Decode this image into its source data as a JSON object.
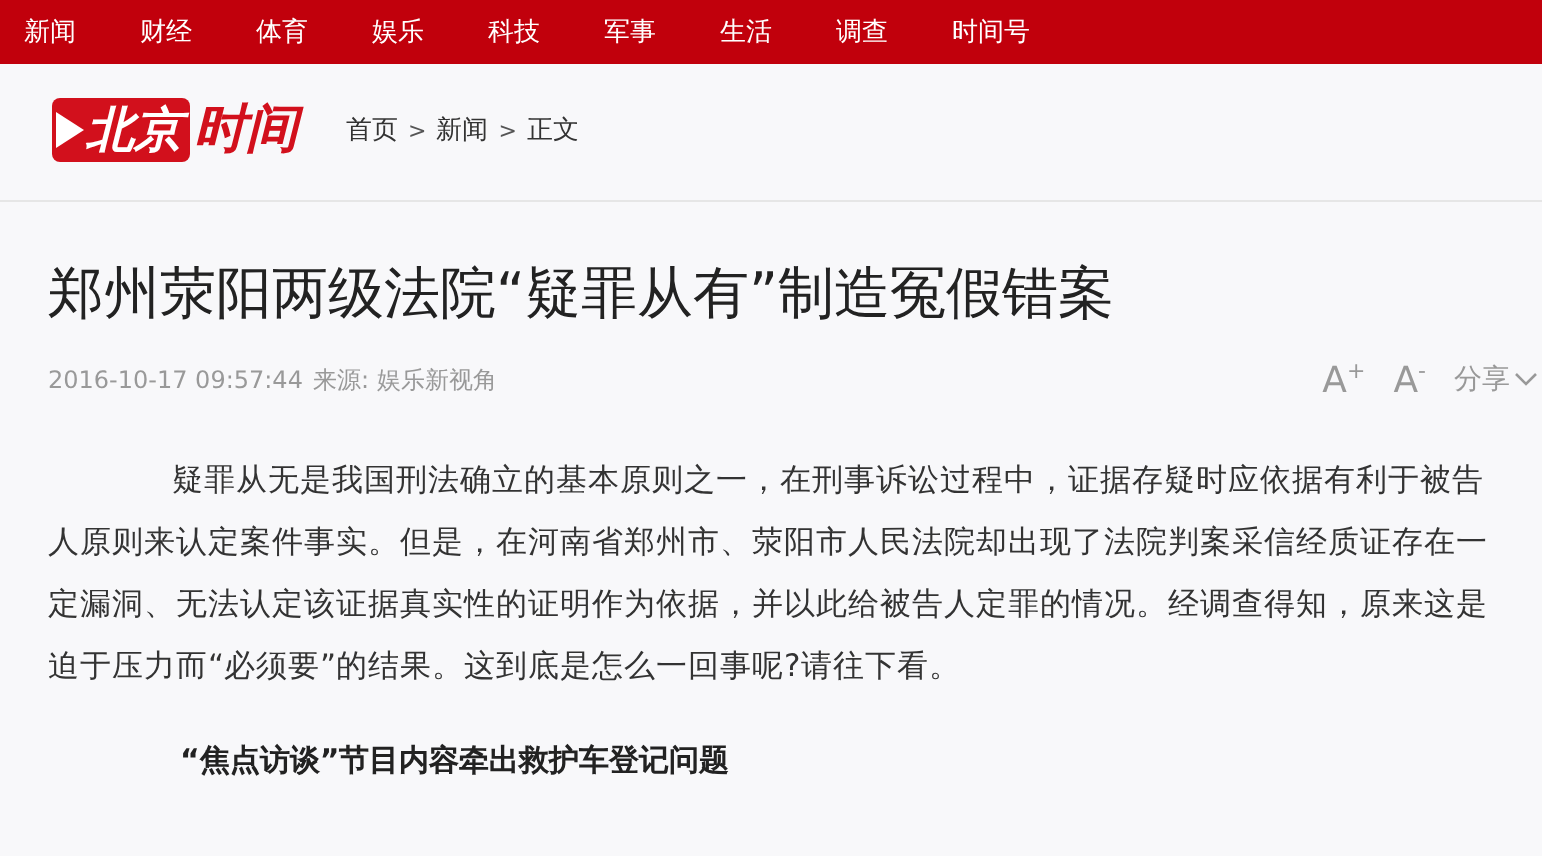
{
  "nav": [
    {
      "label": "新闻"
    },
    {
      "label": "财经"
    },
    {
      "label": "体育"
    },
    {
      "label": "娱乐"
    },
    {
      "label": "科技"
    },
    {
      "label": "军事"
    },
    {
      "label": "生活"
    },
    {
      "label": "调查"
    },
    {
      "label": "时间号"
    }
  ],
  "logo": {
    "boxed": "北京",
    "plain": "时间"
  },
  "breadcrumb": [
    "首页",
    "新闻",
    "正文"
  ],
  "breadcrumb_separator": ">",
  "title": "郑州荥阳两级法院“疑罪从有”制造冤假错案",
  "meta": {
    "date": "2016-10-17 09:57:44",
    "source": "来源: 娱乐新视角"
  },
  "tools": {
    "font_up": "A",
    "font_up_mark": "+",
    "font_down": "A",
    "font_down_mark": "-",
    "share": "分享"
  },
  "paragraph": "疑罪从无是我国刑法确立的基本原则之一，在刑事诉讼过程中，证据存疑时应依据有利于被告人原则来认定案件事实。但是，在河南省郑州市、荥阳市人民法院却出现了法院判案采信经质证存在一定漏洞、无法认定该证据真实性的证明作为依据，并以此给被告人定罪的情况。经调查得知，原来这是迫于压力而“必须要”的结果。这到底是怎么一回事呢?请往下看。",
  "subheading": "“焦点访谈”节目内容牵出救护车登记问题"
}
